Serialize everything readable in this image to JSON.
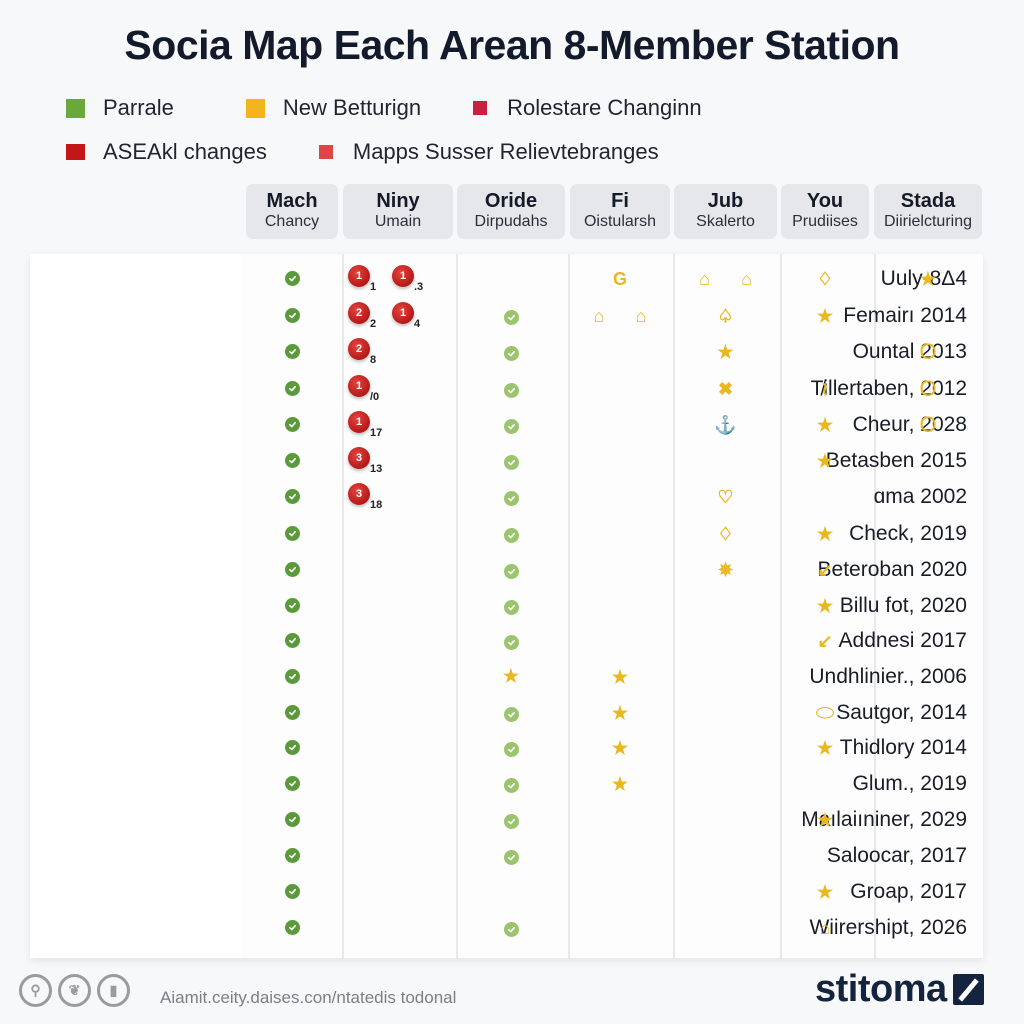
{
  "title": "Socia Map Each Arean 8-Member Station",
  "legend": [
    {
      "label": "Parrale",
      "color": "#6aa83a",
      "size": "large"
    },
    {
      "label": "New Betturign",
      "color": "#f2b61c",
      "size": "large"
    },
    {
      "label": "Rolestare Changinn",
      "color": "#c8203f",
      "size": "small"
    },
    {
      "label": "ASEAkl changes",
      "color": "#c41616",
      "size": "large"
    },
    {
      "label": "Mapps Susser Relievtebranges",
      "color": "#e04545",
      "size": "small"
    }
  ],
  "columns": [
    {
      "title": "Mach",
      "subtitle": "Chancy"
    },
    {
      "title": "Niny",
      "subtitle": "Umain"
    },
    {
      "title": "Oride",
      "subtitle": "Dirpudahs"
    },
    {
      "title": "Fi",
      "subtitle": "Oistularsh"
    },
    {
      "title": "Jub",
      "subtitle": "Skalerto"
    },
    {
      "title": "You",
      "subtitle": "Prudiises"
    },
    {
      "title": "Stada",
      "subtitle": "Diirielcturing"
    }
  ],
  "rows": [
    {
      "label": "Uuly-8Δ4"
    },
    {
      "label": "Femairı 2014"
    },
    {
      "label": "Ountal 2013"
    },
    {
      "label": "T̸illertaben, 2012"
    },
    {
      "label": "Cheur, 2028"
    },
    {
      "label": "Betasben 2015"
    },
    {
      "label": "ɑma 2002"
    },
    {
      "label": "Check, 2019"
    },
    {
      "label": "Beteroban 2020"
    },
    {
      "label": "Billu fot, 2020"
    },
    {
      "label": "Addnesi 2017"
    },
    {
      "label": "Undhlinier., 2006"
    },
    {
      "label": "Sautgor, 2014"
    },
    {
      "label": "Thidlory 2014"
    },
    {
      "label": "Glum., 2019"
    },
    {
      "label": "Maılaiıniner, 2029"
    },
    {
      "label": "Saloocar, 2017"
    },
    {
      "label": "Groap, 2017"
    },
    {
      "label": "Wiirershipt, 2026"
    }
  ],
  "cells": {
    "mach": [
      1,
      1,
      1,
      1,
      1,
      1,
      1,
      1,
      1,
      1,
      1,
      1,
      1,
      1,
      1,
      1,
      1,
      1,
      1
    ],
    "niny": [
      [
        {
          "n": "1",
          "sub": "1"
        },
        {
          "n": "1",
          "sub": ".3"
        }
      ],
      [
        {
          "n": "2",
          "sub": "2"
        },
        {
          "n": "1",
          "sub": "4"
        }
      ],
      [
        {
          "n": "2",
          "sub": "8"
        }
      ],
      [
        {
          "n": "1",
          "sub": "/0"
        }
      ],
      [
        {
          "n": "1",
          "sub": "17"
        }
      ],
      [
        {
          "n": "3",
          "sub": "13"
        }
      ],
      [
        {
          "n": "3",
          "sub": "18"
        }
      ],
      [],
      [],
      [],
      [],
      [],
      [],
      [],
      [],
      [],
      [],
      [],
      []
    ],
    "oride": [
      "",
      "dot",
      "dot",
      "dot",
      "dot",
      "dot",
      "dot",
      "dot",
      "dot",
      "dot",
      "dot",
      "star",
      "dot",
      "dot",
      "dot",
      "dot",
      "dot",
      "",
      "dot"
    ],
    "fi": [
      [
        "ring-g"
      ],
      [
        "bell",
        "bell"
      ],
      [],
      [],
      [],
      [],
      [],
      [],
      [],
      [],
      [],
      [
        "star"
      ],
      [
        "star"
      ],
      [
        "star"
      ],
      [
        "star"
      ],
      [],
      [],
      [],
      []
    ],
    "jub": [
      [
        "bell",
        "bell"
      ],
      [
        "leaf"
      ],
      [
        "star"
      ],
      [
        "cross"
      ],
      [
        "anchor"
      ],
      [],
      [
        "cup"
      ],
      [
        "drop"
      ],
      [
        "crab"
      ],
      [],
      [],
      [],
      [],
      [],
      [],
      [],
      [],
      [],
      []
    ],
    "you": [
      [
        "drop"
      ],
      [
        "star"
      ],
      [],
      [
        "swirl"
      ],
      [
        "star"
      ],
      [
        "star"
      ],
      [],
      [
        "star"
      ],
      [
        "arrow"
      ],
      [
        "star"
      ],
      [
        "arrow"
      ],
      [],
      [
        "oval"
      ],
      [
        "star"
      ],
      [],
      [
        "star"
      ],
      [],
      [
        "star"
      ],
      [
        "bell"
      ]
    ],
    "stada": [
      [
        "star"
      ],
      [],
      [
        "ring"
      ],
      [
        "ring"
      ],
      [
        "ring"
      ],
      [],
      [],
      [],
      [],
      [],
      [],
      [],
      [],
      [],
      [],
      [],
      [],
      [],
      []
    ]
  },
  "glyphs": {
    "star": "★",
    "ring": "O",
    "ring-g": "G",
    "bell": "⌂",
    "leaf": "♤",
    "cross": "✖",
    "anchor": "⚓",
    "cup": "♡",
    "drop": "♢",
    "crab": "✵",
    "swirl": "≀",
    "arrow": "↙",
    "oval": "⬭"
  },
  "colors": {
    "check_dark": "#5b9a3a",
    "check_pale": "#9bc46e",
    "gold": "#e8b81e",
    "badge_red": "#b51818"
  },
  "footer": {
    "social_icons": [
      "instagram-icon",
      "twitter-icon",
      "bookmark-icon"
    ],
    "url_text": "Aiamit.ceity.daises.con/ntatedis todonal",
    "brand": "stitoma"
  }
}
